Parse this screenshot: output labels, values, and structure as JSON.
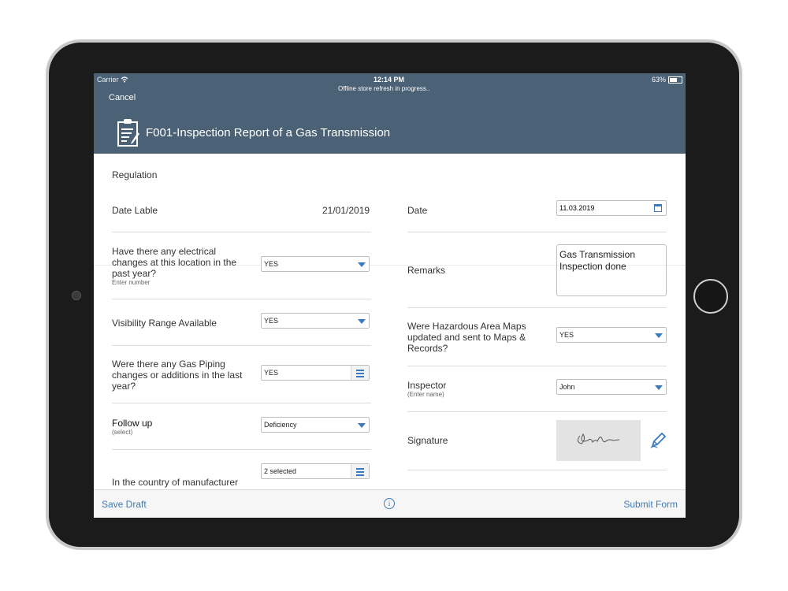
{
  "status_bar": {
    "carrier": "Carrier",
    "time": "12:14 PM",
    "message": "Offline store refresh in progress..",
    "battery": "63%"
  },
  "header": {
    "cancel_label": "Cancel",
    "title": "F001-Inspection Report of a Gas Transmission"
  },
  "section": {
    "title": "Regulation"
  },
  "left": {
    "date_label": "Date Lable",
    "date_value": "21/01/2019",
    "electrical_label": "Have there any electrical changes at this location in the past year?",
    "electrical_hint": "Enter number",
    "electrical_value": "YES",
    "visibility_label": "Visibility Range Available",
    "visibility_value": "YES",
    "piping_label": "Were there any Gas Piping changes or additions in the last year?",
    "piping_value": "YES",
    "followup_label": "Follow up",
    "followup_hint": "(select)",
    "followup_value": "Deficiency",
    "country_label": "In the country of manufacturer",
    "country_value": "2 selected"
  },
  "right": {
    "date_label": "Date",
    "date_value": "11.03.2019",
    "remarks_label": "Remarks",
    "remarks_value": "Gas Transmission Inspection done",
    "maps_label": "Were Hazardous Area Maps updated and sent to Maps & Records?",
    "maps_value": "YES",
    "inspector_label": "Inspector",
    "inspector_hint": "(Enter name)",
    "inspector_value": "John",
    "signature_label": "Signature"
  },
  "bottom_bar": {
    "save_draft": "Save Draft",
    "info": "i",
    "submit": "Submit Form"
  },
  "colors": {
    "header": "#4b6176",
    "accent": "#3f7bb6"
  },
  "icons": [
    "wifi-icon",
    "battery-icon",
    "clipboard-icon",
    "calendar-icon",
    "dropdown-caret-icon",
    "list-icon",
    "pen-icon",
    "info-icon"
  ]
}
